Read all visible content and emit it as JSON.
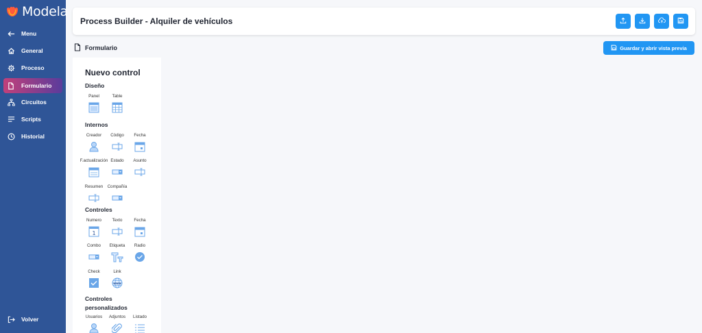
{
  "app": {
    "name": "Modela"
  },
  "sidebar": {
    "items": [
      {
        "label": "Menu",
        "icon": "arrow-left-icon"
      },
      {
        "label": "General",
        "icon": "home-icon"
      },
      {
        "label": "Proceso",
        "icon": "gear-icon"
      },
      {
        "label": "Formulario",
        "icon": "document-icon",
        "active": true
      },
      {
        "label": "Circuitos",
        "icon": "sitemap-icon"
      },
      {
        "label": "Scripts",
        "icon": "lines-icon"
      },
      {
        "label": "Historial",
        "icon": "clock-icon"
      }
    ],
    "footer_label": "Volver"
  },
  "header": {
    "title": "Process Builder - Alquiler de vehículos",
    "actions": [
      "upload-icon",
      "download-icon",
      "cloud-upload-icon",
      "save-icon"
    ]
  },
  "subheader": {
    "title": "Formulario",
    "save_preview_label": "Guardar y abrir vista previa"
  },
  "controls_panel": {
    "title": "Nuevo control",
    "sections": {
      "diseno": {
        "title": "Diseño",
        "items": [
          "Panel",
          "Table"
        ]
      },
      "internos": {
        "title": "Internos",
        "items": [
          "Creador",
          "Código",
          "Fecha",
          "F.actualización",
          "Estado",
          "Asunto",
          "Resumen",
          "Compañía"
        ]
      },
      "controles": {
        "title": "Controles",
        "items": [
          "Numero",
          "Texto",
          "Fecha",
          "Combo",
          "Etiqueta",
          "Radio",
          "Check",
          "Link"
        ]
      },
      "personalizados": {
        "title": "Controles personalizados",
        "items": [
          "Usuarios",
          "Adjuntos",
          "Listado"
        ]
      }
    }
  },
  "colors": {
    "sidebar_bg": "#2f5597",
    "accent": "#2196f3",
    "active_gradient_start": "#c2407a",
    "active_gradient_end": "#5a3c9c",
    "icon_blue": "#6aa6e8"
  }
}
